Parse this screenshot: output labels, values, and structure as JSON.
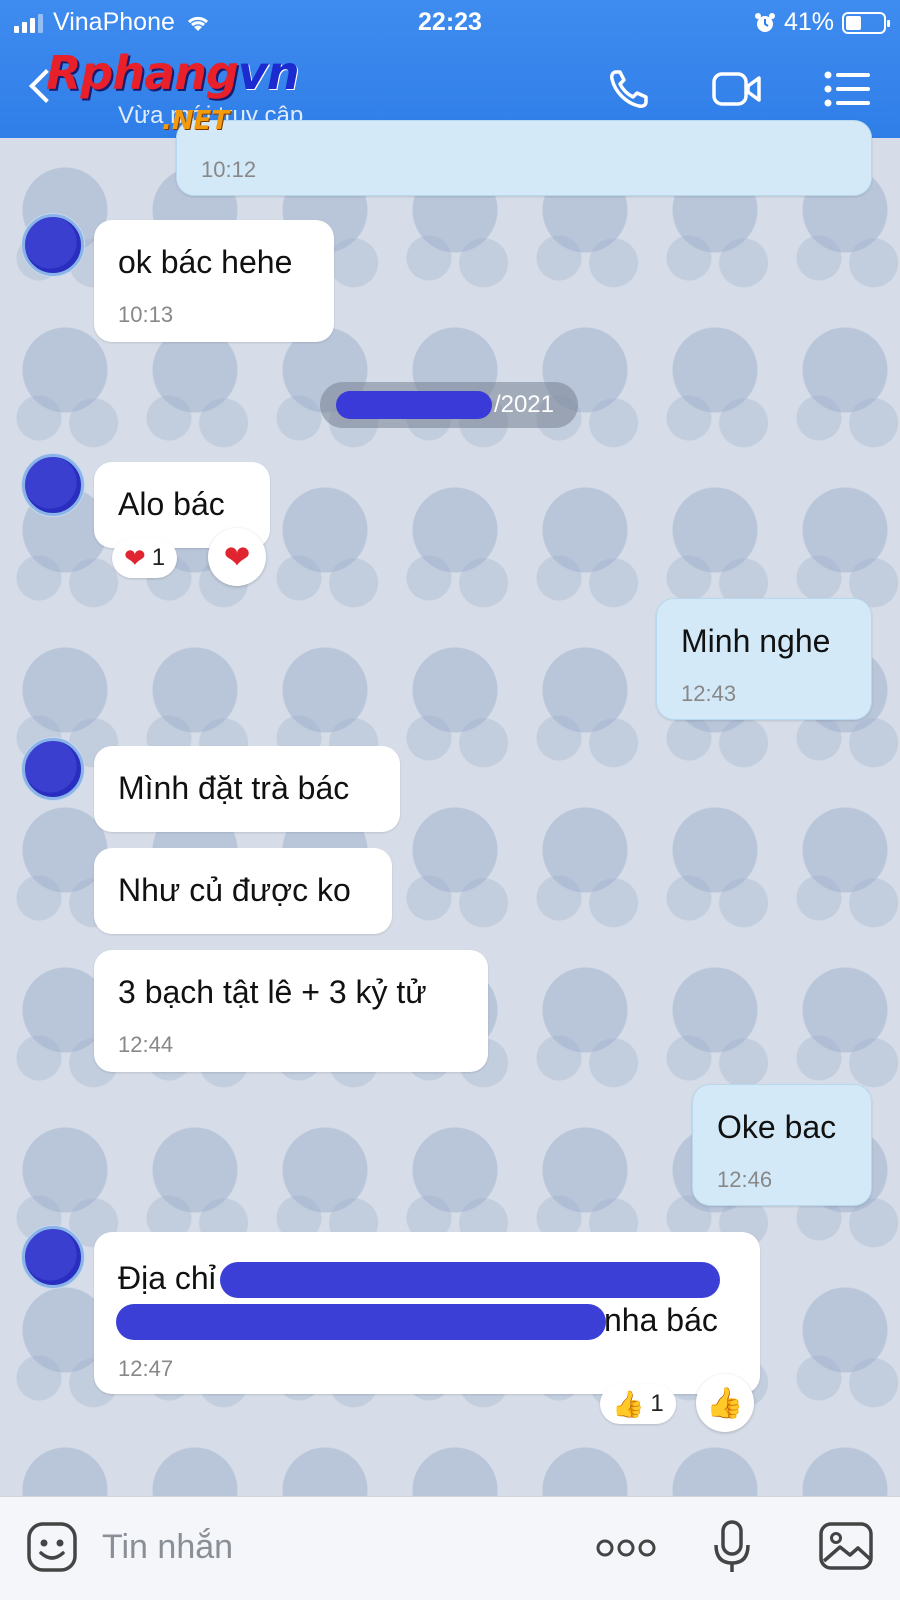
{
  "status_bar": {
    "carrier": "VinaPhone",
    "time": "22:23",
    "battery": "41%",
    "battery_level": 0.41
  },
  "header": {
    "logo_main_red": "Rphang",
    "logo_main_blue": "vn",
    "logo_suffix": ".NET",
    "presence": "Vừa mới truy cập"
  },
  "messages": {
    "m0": {
      "time": "10:12"
    },
    "m1": {
      "text": "ok bác hehe",
      "time": "10:13"
    },
    "date_separator": "/2021",
    "m2": {
      "text": "Alo bác",
      "reaction_count": "1"
    },
    "m3": {
      "text": "Minh nghe",
      "time": "12:43"
    },
    "m4": {
      "text": "Mình đặt trà bác"
    },
    "m5": {
      "text": "Như củ được ko"
    },
    "m6": {
      "text": "3 bạch tật lê + 3 kỷ tử",
      "time": "12:44"
    },
    "m7": {
      "text": "Oke bac",
      "time": "12:46"
    },
    "m8": {
      "line1": "Địa chỉ",
      "line2": "nha bác",
      "time": "12:47",
      "reaction_count": "1"
    }
  },
  "composer": {
    "placeholder": "Tin nhắn"
  },
  "colors": {
    "header_blue": "#2f7ee8",
    "my_bubble": "#d3e9f7",
    "redaction": "#3b3fd6"
  }
}
